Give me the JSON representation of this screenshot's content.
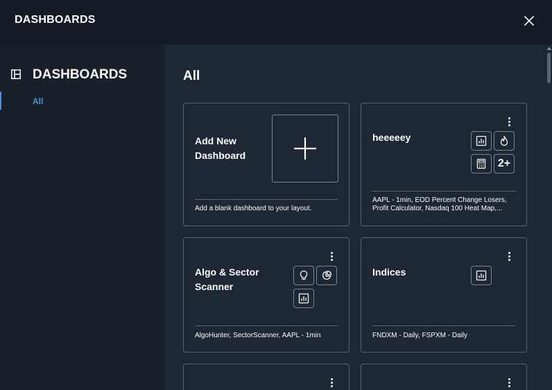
{
  "topbar": {
    "title": "DASHBOARDS",
    "close_icon": "close-icon"
  },
  "sidebar": {
    "title": "DASHBOARDS",
    "icon": "layout-icon",
    "items": [
      {
        "label": "All",
        "active": true
      }
    ]
  },
  "main": {
    "title": "All",
    "add_card": {
      "title_line1": "Add New",
      "title_line2": "Dashboard",
      "description": "Add a blank dashboard to your layout."
    },
    "cards": [
      {
        "title_line1": "heeeeey",
        "title_line2": "",
        "description_line1": "AAPL - 1min, EOD Percent Change Losers,",
        "description_line2": "Profit Calculator, Nasdaq 100 Heat Map,...",
        "widgets": [
          "chart-icon",
          "flame-icon",
          "calculator-icon"
        ],
        "more_count": "2+"
      },
      {
        "title_line1": "Algo & Sector",
        "title_line2": "Scanner",
        "description_line1": "AlgoHunter, SectorScanner, AAPL - 1min",
        "description_line2": "",
        "widgets": [
          "lightbulb-icon",
          "pie-chart-icon",
          "chart-icon"
        ]
      },
      {
        "title_line1": "Indices",
        "title_line2": "",
        "description_line1": "FNDXM - Daily, FSPXM - Daily",
        "description_line2": "",
        "widgets": [
          "chart-icon"
        ]
      }
    ]
  },
  "colors": {
    "topbar_bg": "#141b25",
    "sidebar_bg": "#182029",
    "main_bg": "#1e2734",
    "card_border": "#5a6572",
    "accent": "#4a90e2"
  }
}
